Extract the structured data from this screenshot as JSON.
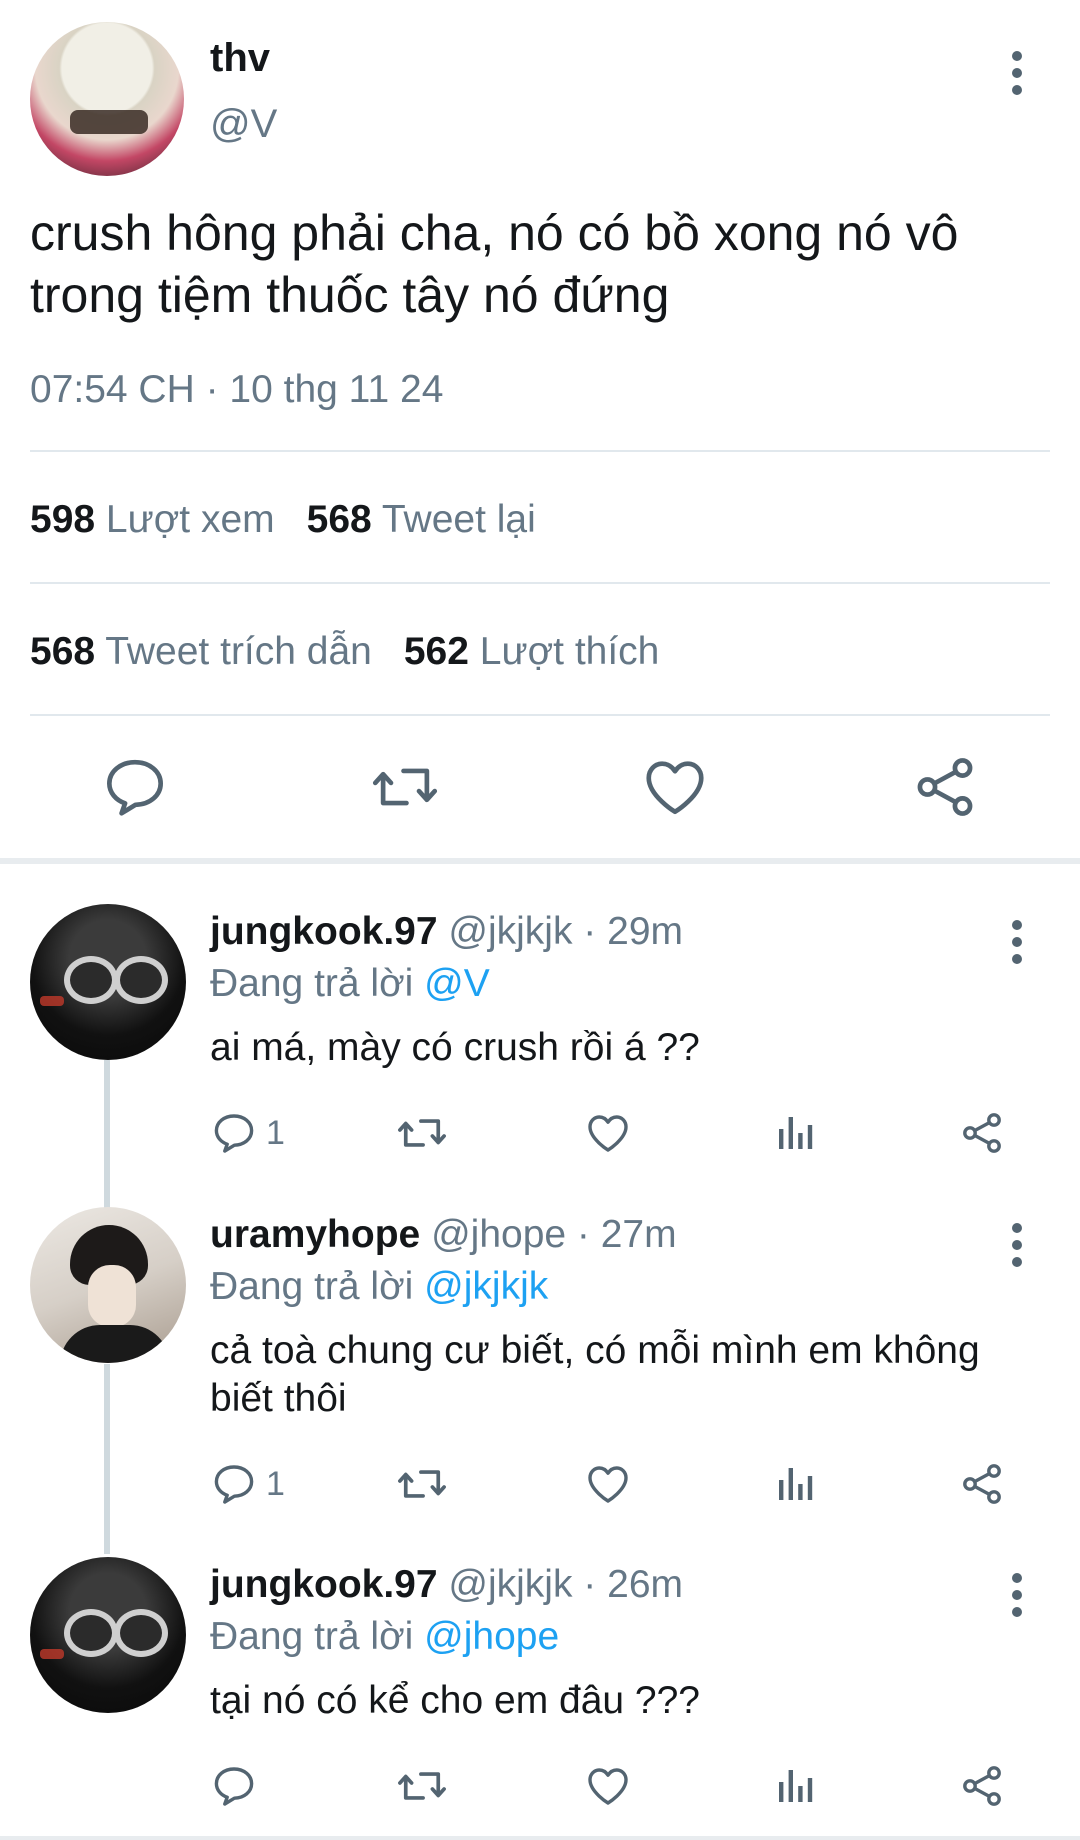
{
  "main_tweet": {
    "author_name": "thv",
    "author_handle": "@V",
    "text_line1": "crush hông phải cha, nó có bồ xong nó vô",
    "text_line2": "trong tiệm thuốc tây nó đứng",
    "timestamp": "07:54 CH · 10 thg 11 24",
    "stats": {
      "views_count": "598",
      "views_label": "Lượt xem",
      "retweets_count": "568",
      "retweets_label": "Tweet lại",
      "quotes_count": "568",
      "quotes_label": "Tweet trích dẫn",
      "likes_count": "562",
      "likes_label": "Lượt thích"
    },
    "actions": [
      "reply-icon",
      "retweet-icon",
      "like-icon",
      "share-icon"
    ]
  },
  "replies": [
    {
      "name": "jungkook.97",
      "meta": "@jkjkjk · 29m",
      "replying_prefix": "Đang trả lời ",
      "replying_to": "@V",
      "text": "ai má, mày có crush rồi á ??",
      "reply_count": "1"
    },
    {
      "name": "uramyhope",
      "meta": "@jhope · 27m",
      "replying_prefix": "Đang trả lời ",
      "replying_to": "@jkjkjk",
      "text_line1": "cả toà chung cư biết, có mỗi mình em không",
      "text_line2": "biết thôi",
      "reply_count": "1"
    },
    {
      "name": "jungkook.97",
      "meta": "@jkjkjk · 26m",
      "replying_prefix": "Đang trả lời ",
      "replying_to": "@jhope",
      "text": "tại nó có kể cho em đâu ???",
      "reply_count": ""
    }
  ],
  "colors": {
    "text": "#14171a",
    "muted": "#657786",
    "link": "#1da1f2",
    "icon": "#536471",
    "divider": "#e1e8ed"
  }
}
